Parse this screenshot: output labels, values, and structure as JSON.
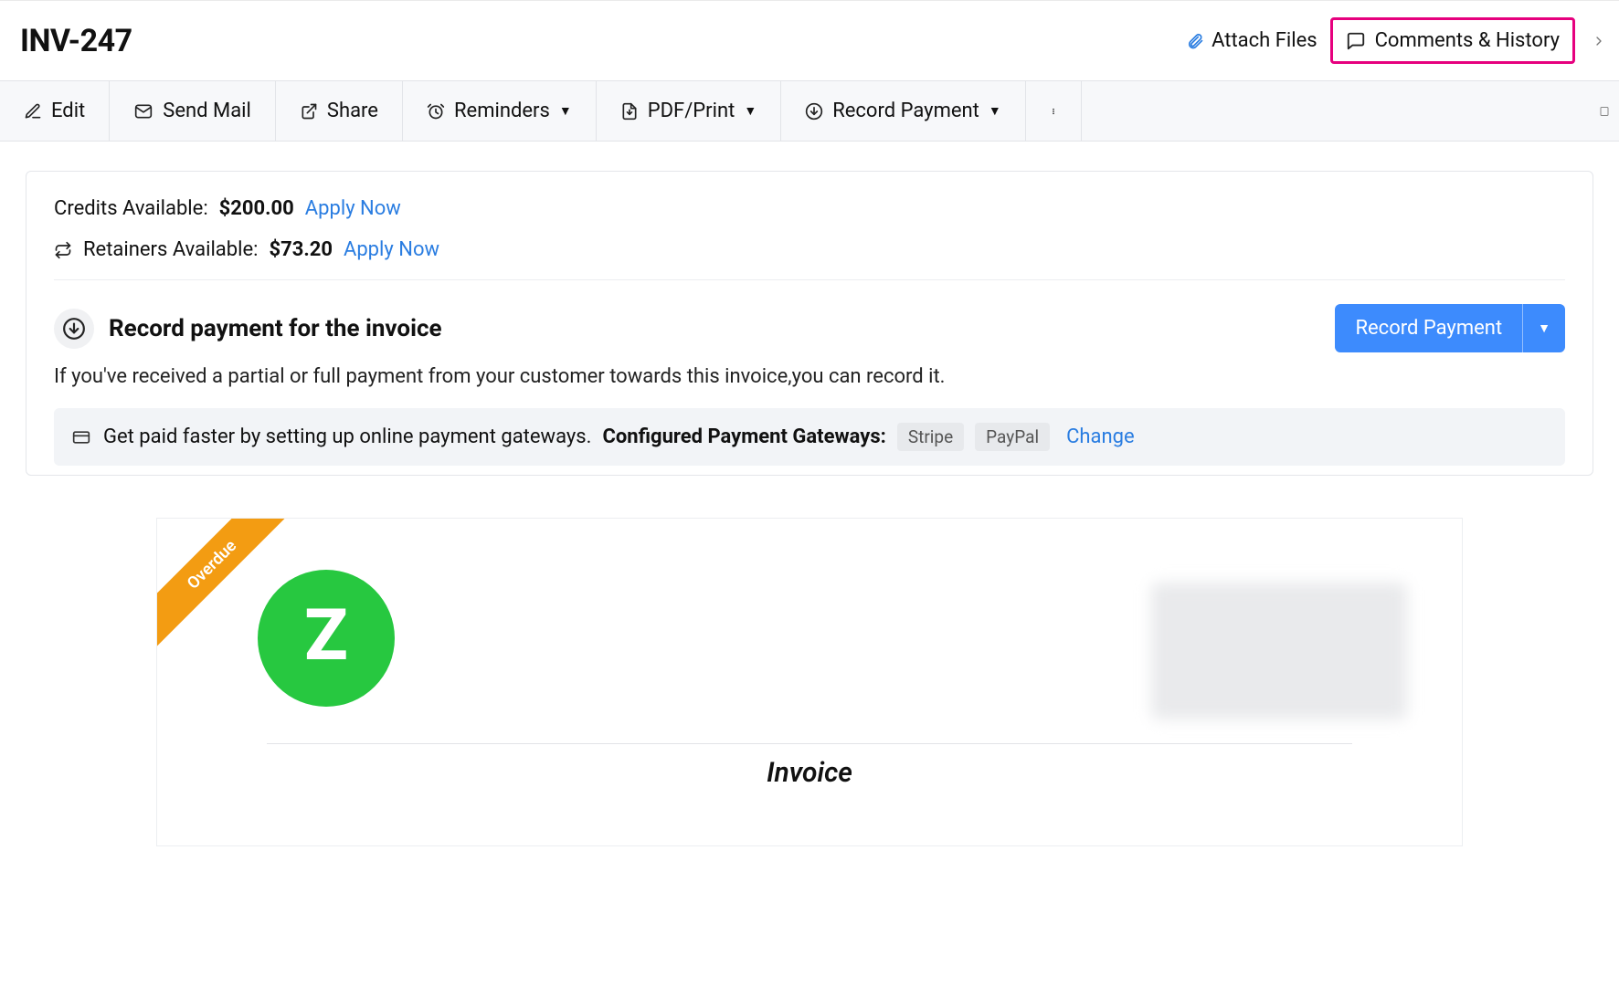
{
  "header": {
    "title": "INV-247",
    "attach_files": "Attach Files",
    "comments_history": "Comments & History"
  },
  "toolbar": {
    "edit": "Edit",
    "send_mail": "Send Mail",
    "share": "Share",
    "reminders": "Reminders",
    "pdf_print": "PDF/Print",
    "record_payment": "Record Payment"
  },
  "credits": {
    "label": "Credits Available:",
    "amount": "$200.00",
    "apply": "Apply Now"
  },
  "retainers": {
    "label": "Retainers Available:",
    "amount": "$73.20",
    "apply": "Apply Now"
  },
  "record_section": {
    "title": "Record payment for the invoice",
    "description": "If you've received a partial or full payment from your customer towards this invoice,you can record it.",
    "button": "Record Payment"
  },
  "gateway": {
    "lead": "Get paid faster by setting up online payment gateways.",
    "configured_label": "Configured Payment Gateways:",
    "chips": [
      "Stripe",
      "PayPal"
    ],
    "change": "Change"
  },
  "invoice_preview": {
    "ribbon": "Overdue",
    "doc_title": "Invoice"
  }
}
